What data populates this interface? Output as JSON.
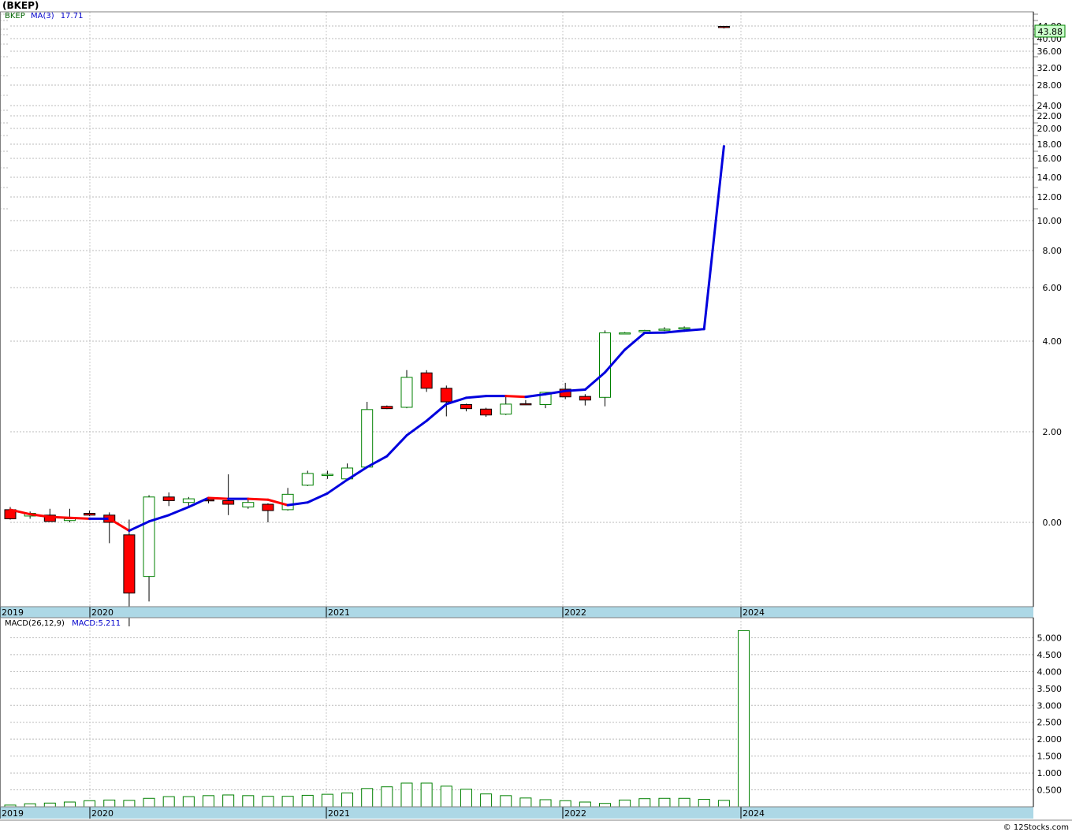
{
  "title": "(BKEP)",
  "legend": {
    "symbol": "BKEP",
    "ma_label": "MA(3)",
    "ma_value": "17.71"
  },
  "last_price": "43.88",
  "macd": {
    "label": "MACD(26,12,9)",
    "value_label": "MACD:5.211"
  },
  "footer": "© 12Stocks.com",
  "colors": {
    "up": "#008000",
    "down": "#ff0000",
    "ma_down": "#ff0000",
    "ma_up": "#0000dd",
    "axis_band": "#add8e6",
    "price_tag": "#ccffcc"
  },
  "chart_data": [
    {
      "type": "candlestick",
      "yscale": "log",
      "y_tick_labels": [
        "0.00",
        "2.00",
        "4.00",
        "6.00",
        "8.00",
        "10.00",
        "12.00",
        "14.00",
        "16.00",
        "18.00",
        "20.00",
        "22.00",
        "24.00",
        "28.00",
        "32.00",
        "36.00",
        "40.00",
        "44.00"
      ],
      "x_tick_labels": [
        "2019",
        "2020",
        "2021",
        "2022",
        "2024"
      ],
      "candles": [
        {
          "o": 1.14,
          "h": 1.17,
          "l": 1.03,
          "c": 1.04
        },
        {
          "o": 1.07,
          "h": 1.12,
          "l": 1.04,
          "c": 1.1
        },
        {
          "o": 1.08,
          "h": 1.15,
          "l": 1.01,
          "c": 1.01
        },
        {
          "o": 1.02,
          "h": 1.15,
          "l": 1.0,
          "c": 1.04
        },
        {
          "o": 1.1,
          "h": 1.13,
          "l": 1.07,
          "c": 1.08
        },
        {
          "o": 1.08,
          "h": 1.11,
          "l": 0.95,
          "c": 1.0
        },
        {
          "o": 0.97,
          "h": 1.03,
          "l": 0.4,
          "c": 0.83
        },
        {
          "o": 0.87,
          "h": 1.3,
          "l": 0.81,
          "c": 1.28
        },
        {
          "o": 1.28,
          "h": 1.33,
          "l": 1.18,
          "c": 1.24
        },
        {
          "o": 1.22,
          "h": 1.28,
          "l": 1.17,
          "c": 1.26
        },
        {
          "o": 1.25,
          "h": 1.28,
          "l": 1.21,
          "c": 1.24
        },
        {
          "o": 1.24,
          "h": 1.53,
          "l": 1.08,
          "c": 1.2
        },
        {
          "o": 1.17,
          "h": 1.27,
          "l": 1.15,
          "c": 1.22
        },
        {
          "o": 1.2,
          "h": 1.21,
          "l": 1.0,
          "c": 1.13
        },
        {
          "o": 1.14,
          "h": 1.38,
          "l": 1.13,
          "c": 1.31
        },
        {
          "o": 1.41,
          "h": 1.57,
          "l": 1.4,
          "c": 1.54
        },
        {
          "o": 1.53,
          "h": 1.57,
          "l": 1.48,
          "c": 1.53
        },
        {
          "o": 1.48,
          "h": 1.65,
          "l": 1.46,
          "c": 1.6
        },
        {
          "o": 1.61,
          "h": 2.66,
          "l": 1.6,
          "c": 2.49
        },
        {
          "o": 2.56,
          "h": 2.58,
          "l": 2.5,
          "c": 2.51
        },
        {
          "o": 2.54,
          "h": 3.36,
          "l": 2.52,
          "c": 3.2
        },
        {
          "o": 3.3,
          "h": 3.36,
          "l": 2.88,
          "c": 2.96
        },
        {
          "o": 2.96,
          "h": 3.02,
          "l": 2.34,
          "c": 2.66
        },
        {
          "o": 2.6,
          "h": 2.62,
          "l": 2.45,
          "c": 2.51
        },
        {
          "o": 2.5,
          "h": 2.53,
          "l": 2.33,
          "c": 2.37
        },
        {
          "o": 2.39,
          "h": 2.81,
          "l": 2.37,
          "c": 2.61
        },
        {
          "o": 2.62,
          "h": 2.7,
          "l": 2.59,
          "c": 2.6
        },
        {
          "o": 2.6,
          "h": 2.81,
          "l": 2.52,
          "c": 2.87
        },
        {
          "o": 2.94,
          "h": 3.08,
          "l": 2.72,
          "c": 2.77
        },
        {
          "o": 2.78,
          "h": 2.83,
          "l": 2.58,
          "c": 2.7
        },
        {
          "o": 2.76,
          "h": 4.4,
          "l": 2.56,
          "c": 4.31
        },
        {
          "o": 4.31,
          "h": 4.34,
          "l": 4.28,
          "c": 4.31
        },
        {
          "o": 4.35,
          "h": 4.42,
          "l": 4.31,
          "c": 4.4
        },
        {
          "o": 4.41,
          "h": 4.52,
          "l": 4.38,
          "c": 4.45
        },
        {
          "o": 4.47,
          "h": 4.55,
          "l": 4.43,
          "c": 4.5
        },
        {
          "o": null,
          "h": null,
          "l": null,
          "c": null
        },
        {
          "o": 43.88,
          "h": 44.4,
          "l": 43.2,
          "c": 43.55
        }
      ],
      "ma": [
        1.14,
        1.09,
        1.06,
        1.05,
        1.04,
        1.04,
        0.98,
        1.01,
        1.08,
        1.17,
        1.27,
        1.26,
        1.26,
        1.25,
        1.19,
        1.22,
        1.32,
        1.47,
        1.61,
        1.73,
        1.96,
        2.24,
        2.61,
        2.75,
        2.79,
        2.79,
        2.77,
        2.83,
        2.9,
        2.93,
        3.31,
        3.81,
        4.31,
        4.32,
        4.39,
        4.45,
        17.71
      ]
    },
    {
      "type": "bar",
      "name": "MACD(26,12,9)",
      "y_tick_labels": [
        "0.500",
        "1.000",
        "1.500",
        "2.000",
        "2.500",
        "3.000",
        "3.500",
        "4.000",
        "4.500",
        "5.000"
      ],
      "ylim": [
        0,
        5.5
      ],
      "x_tick_labels": [
        "2019",
        "2020",
        "2021",
        "2022",
        "2024"
      ],
      "values": [
        0.05,
        0.09,
        0.11,
        0.14,
        0.18,
        0.2,
        0.19,
        0.25,
        0.3,
        0.3,
        0.33,
        0.35,
        0.33,
        0.31,
        0.31,
        0.34,
        0.37,
        0.41,
        0.54,
        0.59,
        0.7,
        0.7,
        0.61,
        0.52,
        0.38,
        0.33,
        0.26,
        0.21,
        0.18,
        0.14,
        0.1,
        0.2,
        0.24,
        0.25,
        0.25,
        0.22,
        0.19,
        5.211
      ]
    }
  ]
}
